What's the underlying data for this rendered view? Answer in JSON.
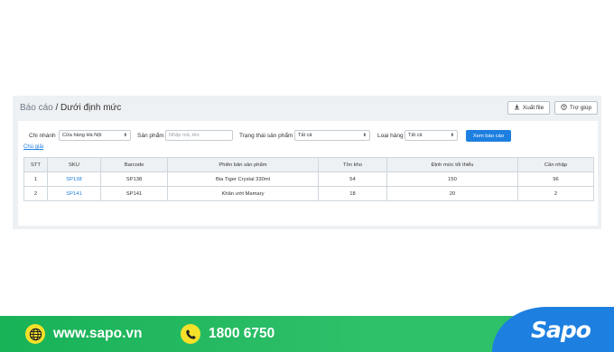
{
  "header": {
    "breadcrumb_root": "Báo cáo",
    "breadcrumb_separator": " / ",
    "breadcrumb_current": "Dưới định mức",
    "export_label": "Xuất file",
    "help_label": "Trợ giúp"
  },
  "filters": {
    "branch_label": "Chi nhánh",
    "branch_value": "Cửa hàng Hà Nội",
    "product_label": "Sản phẩm",
    "product_placeholder": "Nhập mã, tên",
    "status_label": "Trạng thái sản phẩm",
    "status_value": "Tất cả",
    "type_label": "Loại hàng",
    "type_value": "Tất cả",
    "submit_label": "Xem báo cáo",
    "legend_link": "Chú giải"
  },
  "table": {
    "columns": [
      "STT",
      "SKU",
      "Barcode",
      "Phiên bản sản phẩm",
      "Tồn kho",
      "Định mức tối thiểu",
      "Cần nhập"
    ],
    "rows": [
      {
        "stt": "1",
        "sku": "SP138",
        "barcode": "SP138",
        "variant": "Bia Tiger Crystal 330ml",
        "stock": "54",
        "min": "150",
        "need": "96"
      },
      {
        "stt": "2",
        "sku": "SP141",
        "barcode": "SP141",
        "variant": "Khăn ướt Mamary",
        "stock": "18",
        "min": "20",
        "need": "2"
      }
    ]
  },
  "footer": {
    "website": "www.sapo.vn",
    "phone": "1800 6750",
    "logo": "Sapo",
    "colors": {
      "green": "#18b257",
      "blue": "#1d7fe0",
      "icon": "#f5e12a"
    }
  },
  "colors": {
    "accent": "#1d7fe0",
    "panel_bg": "#eef1f4"
  }
}
